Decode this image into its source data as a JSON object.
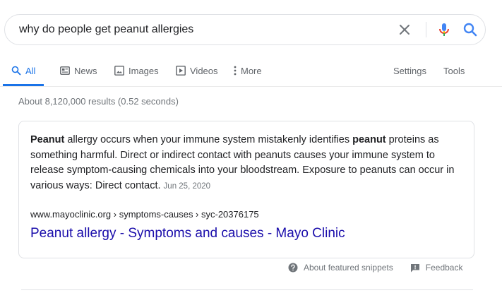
{
  "search": {
    "query": "why do people get peanut allergies"
  },
  "tabs": [
    {
      "label": "All",
      "icon": "search-icon",
      "active": true
    },
    {
      "label": "News",
      "icon": "news-icon"
    },
    {
      "label": "Images",
      "icon": "image-icon"
    },
    {
      "label": "Videos",
      "icon": "video-icon"
    },
    {
      "label": "More",
      "icon": "more-vert-icon"
    }
  ],
  "tools": {
    "settings_label": "Settings",
    "tools_label": "Tools"
  },
  "stats": "About 8,120,000 results (0.52 seconds)",
  "snippet": {
    "p1_bold": "Peanut",
    "p2": " allergy occurs when your immune system mistakenly identifies ",
    "p3_bold": "peanut",
    "p4": " proteins as something harmful. Direct or indirect contact with peanuts causes your immune system to release symptom-causing chemicals into your bloodstream. Exposure to peanuts can occur in various ways: Direct contact.",
    "date": "Jun 25, 2020",
    "cite": "www.mayoclinic.org › symptoms-causes › syc-20376175",
    "title": "Peanut allergy - Symptoms and causes - Mayo Clinic"
  },
  "footer": {
    "about_label": "About featured snippets",
    "feedback_label": "Feedback"
  },
  "colors": {
    "link": "#1a0dab",
    "accent": "#1a73e8",
    "muted": "#70757a"
  }
}
